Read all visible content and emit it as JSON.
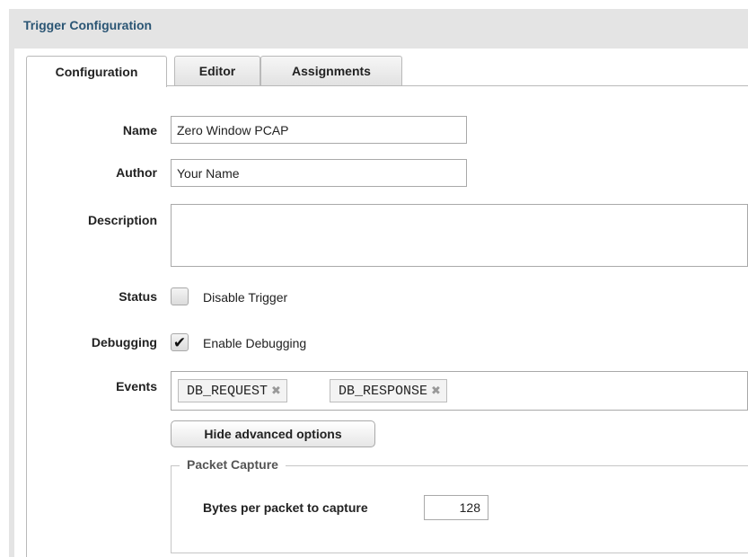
{
  "panel": {
    "title": "Trigger Configuration"
  },
  "tabs": [
    {
      "label": "Configuration",
      "active": true
    },
    {
      "label": "Editor",
      "active": false
    },
    {
      "label": "Assignments",
      "active": false
    }
  ],
  "form": {
    "name": {
      "label": "Name",
      "value": "Zero Window PCAP"
    },
    "author": {
      "label": "Author",
      "value": "Your Name"
    },
    "description": {
      "label": "Description",
      "value": ""
    },
    "status": {
      "label": "Status",
      "checkbox_label": "Disable Trigger",
      "checked": false
    },
    "debugging": {
      "label": "Debugging",
      "checkbox_label": "Enable Debugging",
      "checked": true
    },
    "events": {
      "label": "Events",
      "tags": [
        "DB_REQUEST",
        "DB_RESPONSE"
      ],
      "remove_glyph": "✖"
    },
    "advanced_button": "Hide advanced options",
    "packet_capture": {
      "legend": "Packet Capture",
      "bytes_label": "Bytes per packet to capture",
      "bytes_value": "128"
    }
  },
  "colors": {
    "title": "#2a5574",
    "header_bg": "#e4e4e4",
    "border": "#a9a9a9"
  }
}
